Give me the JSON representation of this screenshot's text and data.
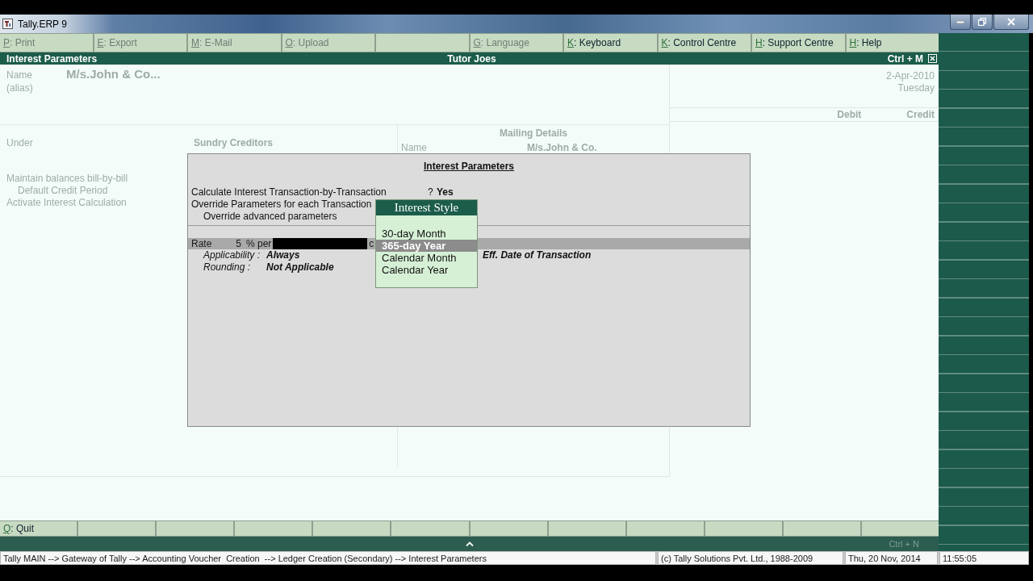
{
  "window": {
    "title": "Tally.ERP 9"
  },
  "toolbar": [
    {
      "kind": "key",
      "key": "P",
      "label": ": Print",
      "disabled": true
    },
    {
      "kind": "key",
      "key": "E",
      "label": ": Export",
      "disabled": true
    },
    {
      "kind": "key",
      "key": "M",
      "label": ": E-Mail",
      "disabled": true
    },
    {
      "kind": "key",
      "key": "O",
      "label": ": Upload",
      "disabled": true
    },
    {
      "kind": "blank"
    },
    {
      "kind": "key",
      "key": "G",
      "label": ": Language",
      "disabled": true
    },
    {
      "kind": "key",
      "key": "K",
      "label": ": Keyboard",
      "disabled": false
    },
    {
      "kind": "key",
      "key": "K",
      "label": ": Control Centre",
      "disabled": false
    },
    {
      "kind": "key",
      "key": "H",
      "label": ": Support Centre",
      "disabled": false
    },
    {
      "kind": "key",
      "key": "H",
      "label": ": Help",
      "disabled": false
    }
  ],
  "header": {
    "title": "Interest Parameters",
    "company": "Tutor Joes",
    "shortcut": "Ctrl + M"
  },
  "background_form": {
    "name_label": "Name",
    "alias_label": "(alias)",
    "name_value": "M/s.John & Co...",
    "date": "2-Apr-2010",
    "day": "Tuesday",
    "columns": [
      "Debit",
      "Credit"
    ],
    "under_label": "Under",
    "under_value": "Sundry Creditors",
    "options": [
      {
        "label": "Maintain balances bill-by-bill",
        "children": [
          {
            "label": "Default Credit Period"
          }
        ]
      },
      {
        "label": "Activate Interest Calculation"
      }
    ],
    "mailing_title": "Mailing Details",
    "mailing_name_label": "Name",
    "mailing_name_value": "M/s.John & Co."
  },
  "dialog": {
    "title": "Interest Parameters",
    "fields": [
      {
        "label": "Calculate Interest Transaction-by-Transaction",
        "prompt": "?",
        "value": "Yes"
      },
      {
        "label": "Override Parameters for each Transaction",
        "children": [
          {
            "label": "Override advanced parameters"
          }
        ]
      }
    ],
    "rate_row": {
      "label": "Rate",
      "value": "5",
      "unit": "% per",
      "column_4": "c"
    },
    "details": [
      {
        "label": "Applicability :",
        "value": "Always"
      },
      {
        "label": "Rounding :",
        "value": "Not Applicable"
      }
    ],
    "side_value": "Eff. Date of Transaction",
    "interest_style_list": {
      "title": "Interest Style",
      "items": [
        {
          "label": "30-day Month",
          "selected": false
        },
        {
          "label": "365-day Year",
          "selected": true
        },
        {
          "label": "Calendar Month",
          "selected": false
        },
        {
          "label": "Calendar Year",
          "selected": false
        }
      ]
    }
  },
  "button_bar": [
    {
      "kind": "key",
      "key": "Q",
      "label": ": Quit",
      "disabled": false
    },
    {
      "kind": "blank"
    },
    {
      "kind": "blank"
    },
    {
      "kind": "blank"
    },
    {
      "kind": "blank"
    },
    {
      "kind": "blank"
    },
    {
      "kind": "blank"
    },
    {
      "kind": "blank"
    },
    {
      "kind": "blank"
    },
    {
      "kind": "blank"
    },
    {
      "kind": "blank"
    },
    {
      "kind": "blank"
    }
  ],
  "footer_strip": {
    "shortcut": "Ctrl + N"
  },
  "status_bar": {
    "path": "Tally MAIN --> Gateway of Tally --> Accounting Voucher  Creation  --> Ledger Creation (Secondary) --> Interest Parameters",
    "copyright": "(c) Tally Solutions Pvt. Ltd., 1988-2009",
    "date": "Thu, 20 Nov, 2014",
    "time": "11:55:05"
  }
}
